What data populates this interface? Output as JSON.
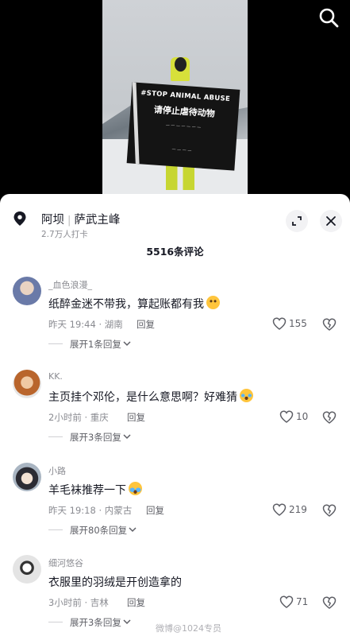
{
  "video": {
    "banner_line1": "#STOP ANIMAL ABUSE",
    "banner_line2": "请停止虐待动物"
  },
  "location": {
    "place": "阿坝",
    "peak": "萨武主峰",
    "checkins": "2.7万人打卡"
  },
  "comments_count": "5516条评论",
  "comments": [
    {
      "user": "_血色浪漫_",
      "text": "纸醉金迷不带我，算起账都有我",
      "meta": "昨天 19:44 · 湖南",
      "reply": "回复",
      "likes": "155",
      "expand": "展开1条回复",
      "avatar_color": "#6a7aa8"
    },
    {
      "user": "KK.",
      "text": "主页挂个邓伦，是什么意思啊？好难猜",
      "meta": "2小时前 · 重庆",
      "reply": "回复",
      "likes": "10",
      "expand": "展开3条回复",
      "avatar_color": "#c97a3a"
    },
    {
      "user": "小路",
      "text": "羊毛袜推荐一下",
      "meta": "昨天 19:18 · 内蒙古",
      "reply": "回复",
      "likes": "219",
      "expand": "展开80条回复",
      "avatar_color": "#8a97a6"
    },
    {
      "user": "细河悠谷",
      "text": "衣服里的羽绒是开创造拿的",
      "meta": "3小时前 · 吉林",
      "reply": "回复",
      "likes": "71",
      "expand": "展开3条回复",
      "avatar_color": "#e4e4e4"
    }
  ],
  "watermark": "微博@1024专员",
  "icons": {
    "search": "search-icon",
    "pin": "location-pin-icon",
    "expand": "expand-icon",
    "close": "close-icon",
    "heart": "heart-icon",
    "dislike": "broken-heart-icon"
  }
}
